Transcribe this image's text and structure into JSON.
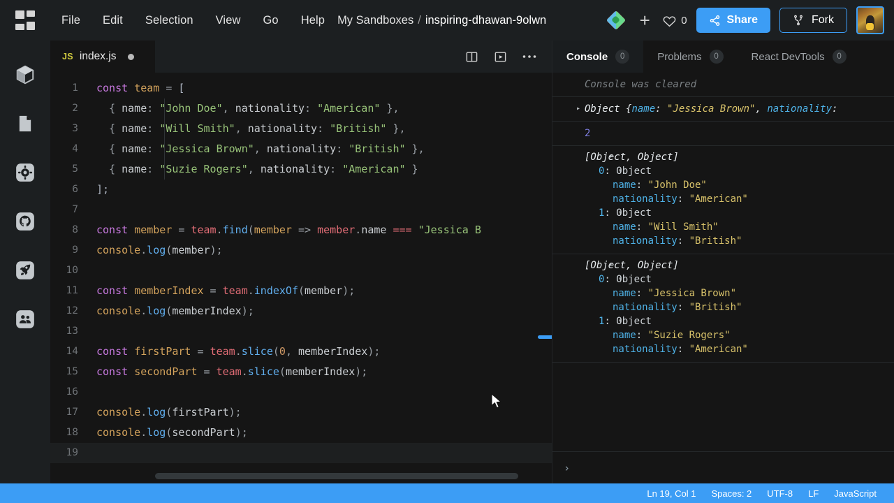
{
  "topbar": {
    "logo_icon": "grid-logo-icon",
    "menus": [
      "File",
      "Edit",
      "Selection",
      "View",
      "Go",
      "Help"
    ],
    "breadcrumb": {
      "root": "My Sandboxes",
      "separator": "/",
      "current": "inspiring-dhawan-9olwn"
    },
    "diamond_icon": "codesandbox-diamond-icon",
    "plus_icon": "plus-icon",
    "heart_icon": "heart-icon",
    "likes_count": "0",
    "share_label": "Share",
    "share_icon": "share-icon",
    "fork_label": "Fork",
    "fork_icon": "fork-icon",
    "avatar_alt": "user-avatar",
    "accent_color": "#3c9df5"
  },
  "activitybar": {
    "items": [
      {
        "name": "sidebar-item-explorer",
        "icon": "cube-icon"
      },
      {
        "name": "sidebar-item-files",
        "icon": "file-icon"
      },
      {
        "name": "sidebar-item-settings",
        "icon": "gear-icon"
      },
      {
        "name": "sidebar-item-github",
        "icon": "github-icon"
      },
      {
        "name": "sidebar-item-deploy",
        "icon": "rocket-icon"
      },
      {
        "name": "sidebar-item-live",
        "icon": "people-icon"
      }
    ]
  },
  "editor": {
    "tab": {
      "lang_badge": "JS",
      "filename": "index.js",
      "modified": true
    },
    "actions": [
      {
        "name": "split-editor-icon"
      },
      {
        "name": "run-preview-icon"
      },
      {
        "name": "more-options-icon"
      }
    ],
    "lines": [
      {
        "n": "1",
        "tokens": [
          [
            "t-kw",
            "const"
          ],
          [
            "t-op",
            " "
          ],
          [
            "t-var",
            "team"
          ],
          [
            "t-op",
            " = "
          ],
          [
            "t-punct",
            "["
          ]
        ]
      },
      {
        "n": "2",
        "tokens": [
          [
            "t-op",
            "  { "
          ],
          [
            "t-prop",
            "name"
          ],
          [
            "t-op",
            ": "
          ],
          [
            "t-str",
            "\"John Doe\""
          ],
          [
            "t-op",
            ", "
          ],
          [
            "t-prop",
            "nationality"
          ],
          [
            "t-op",
            ": "
          ],
          [
            "t-str",
            "\"American\""
          ],
          [
            "t-op",
            " },"
          ]
        ]
      },
      {
        "n": "3",
        "tokens": [
          [
            "t-op",
            "  { "
          ],
          [
            "t-prop",
            "name"
          ],
          [
            "t-op",
            ": "
          ],
          [
            "t-str",
            "\"Will Smith\""
          ],
          [
            "t-op",
            ", "
          ],
          [
            "t-prop",
            "nationality"
          ],
          [
            "t-op",
            ": "
          ],
          [
            "t-str",
            "\"British\""
          ],
          [
            "t-op",
            " },"
          ]
        ]
      },
      {
        "n": "4",
        "tokens": [
          [
            "t-op",
            "  { "
          ],
          [
            "t-prop",
            "name"
          ],
          [
            "t-op",
            ": "
          ],
          [
            "t-str",
            "\"Jessica Brown\""
          ],
          [
            "t-op",
            ", "
          ],
          [
            "t-prop",
            "nationality"
          ],
          [
            "t-op",
            ": "
          ],
          [
            "t-str",
            "\"British\""
          ],
          [
            "t-op",
            " },"
          ]
        ]
      },
      {
        "n": "5",
        "tokens": [
          [
            "t-op",
            "  { "
          ],
          [
            "t-prop",
            "name"
          ],
          [
            "t-op",
            ": "
          ],
          [
            "t-str",
            "\"Suzie Rogers\""
          ],
          [
            "t-op",
            ", "
          ],
          [
            "t-prop",
            "nationality"
          ],
          [
            "t-op",
            ": "
          ],
          [
            "t-str",
            "\"American\""
          ],
          [
            "t-op",
            " }"
          ]
        ]
      },
      {
        "n": "6",
        "tokens": [
          [
            "t-punct",
            "];"
          ]
        ]
      },
      {
        "n": "7",
        "tokens": []
      },
      {
        "n": "8",
        "tokens": [
          [
            "t-kw",
            "const"
          ],
          [
            "t-op",
            " "
          ],
          [
            "t-var",
            "member"
          ],
          [
            "t-op",
            " = "
          ],
          [
            "t-team",
            "team"
          ],
          [
            "t-op",
            "."
          ],
          [
            "t-fn",
            "find"
          ],
          [
            "t-op",
            "("
          ],
          [
            "t-var",
            "member"
          ],
          [
            "t-op",
            " => "
          ],
          [
            "t-team",
            "member"
          ],
          [
            "t-op",
            "."
          ],
          [
            "t-prop",
            "name"
          ],
          [
            "t-op",
            " "
          ],
          [
            "t-eq",
            "==="
          ],
          [
            "t-op",
            " "
          ],
          [
            "t-str",
            "\"Jessica B"
          ]
        ]
      },
      {
        "n": "9",
        "tokens": [
          [
            "t-var",
            "console"
          ],
          [
            "t-op",
            "."
          ],
          [
            "t-fn",
            "log"
          ],
          [
            "t-op",
            "("
          ],
          [
            "t-prop",
            "member"
          ],
          [
            "t-op",
            ");"
          ]
        ]
      },
      {
        "n": "10",
        "tokens": []
      },
      {
        "n": "11",
        "tokens": [
          [
            "t-kw",
            "const"
          ],
          [
            "t-op",
            " "
          ],
          [
            "t-var",
            "memberIndex"
          ],
          [
            "t-op",
            " = "
          ],
          [
            "t-team",
            "team"
          ],
          [
            "t-op",
            "."
          ],
          [
            "t-fn",
            "indexOf"
          ],
          [
            "t-op",
            "("
          ],
          [
            "t-prop",
            "member"
          ],
          [
            "t-op",
            ");"
          ]
        ]
      },
      {
        "n": "12",
        "tokens": [
          [
            "t-var",
            "console"
          ],
          [
            "t-op",
            "."
          ],
          [
            "t-fn",
            "log"
          ],
          [
            "t-op",
            "("
          ],
          [
            "t-prop",
            "memberIndex"
          ],
          [
            "t-op",
            ");"
          ]
        ]
      },
      {
        "n": "13",
        "tokens": []
      },
      {
        "n": "14",
        "tokens": [
          [
            "t-kw",
            "const"
          ],
          [
            "t-op",
            " "
          ],
          [
            "t-var",
            "firstPart"
          ],
          [
            "t-op",
            " = "
          ],
          [
            "t-team",
            "team"
          ],
          [
            "t-op",
            "."
          ],
          [
            "t-fn",
            "slice"
          ],
          [
            "t-op",
            "("
          ],
          [
            "t-num",
            "0"
          ],
          [
            "t-op",
            ", "
          ],
          [
            "t-prop",
            "memberIndex"
          ],
          [
            "t-op",
            ");"
          ]
        ]
      },
      {
        "n": "15",
        "tokens": [
          [
            "t-kw",
            "const"
          ],
          [
            "t-op",
            " "
          ],
          [
            "t-var",
            "secondPart"
          ],
          [
            "t-op",
            " = "
          ],
          [
            "t-team",
            "team"
          ],
          [
            "t-op",
            "."
          ],
          [
            "t-fn",
            "slice"
          ],
          [
            "t-op",
            "("
          ],
          [
            "t-prop",
            "memberIndex"
          ],
          [
            "t-op",
            ");"
          ]
        ]
      },
      {
        "n": "16",
        "tokens": []
      },
      {
        "n": "17",
        "tokens": [
          [
            "t-var",
            "console"
          ],
          [
            "t-op",
            "."
          ],
          [
            "t-fn",
            "log"
          ],
          [
            "t-op",
            "("
          ],
          [
            "t-prop",
            "firstPart"
          ],
          [
            "t-op",
            ");"
          ]
        ]
      },
      {
        "n": "18",
        "tokens": [
          [
            "t-var",
            "console"
          ],
          [
            "t-op",
            "."
          ],
          [
            "t-fn",
            "log"
          ],
          [
            "t-op",
            "("
          ],
          [
            "t-prop",
            "secondPart"
          ],
          [
            "t-op",
            ");"
          ]
        ]
      },
      {
        "n": "19",
        "tokens": [],
        "active": true
      }
    ]
  },
  "console": {
    "tabs": [
      {
        "label": "Console",
        "badge": "0",
        "active": true
      },
      {
        "label": "Problems",
        "badge": "0",
        "active": false
      },
      {
        "label": "React DevTools",
        "badge": "0",
        "active": false
      }
    ],
    "cleared_message": "Console was cleared",
    "entries": [
      {
        "type": "collapsed-object",
        "arrow": "▸",
        "title": "Object",
        "preview": [
          {
            "k": "name",
            "v": "\"Jessica Brown\""
          },
          {
            "k": "nationality",
            "v": ""
          }
        ],
        "truncated": true
      },
      {
        "type": "number",
        "value": "2"
      },
      {
        "type": "expanded-array",
        "arrow": "▾",
        "title": "[Object, Object]",
        "children": [
          {
            "index": "0",
            "label": "Object",
            "props": [
              {
                "k": "name",
                "v": "\"John Doe\""
              },
              {
                "k": "nationality",
                "v": "\"American\""
              }
            ]
          },
          {
            "index": "1",
            "label": "Object",
            "props": [
              {
                "k": "name",
                "v": "\"Will Smith\""
              },
              {
                "k": "nationality",
                "v": "\"British\""
              }
            ]
          }
        ]
      },
      {
        "type": "expanded-array",
        "arrow": "▾",
        "title": "[Object, Object]",
        "children": [
          {
            "index": "0",
            "label": "Object",
            "props": [
              {
                "k": "name",
                "v": "\"Jessica Brown\""
              },
              {
                "k": "nationality",
                "v": "\"British\""
              }
            ]
          },
          {
            "index": "1",
            "label": "Object",
            "props": [
              {
                "k": "name",
                "v": "\"Suzie Rogers\""
              },
              {
                "k": "nationality",
                "v": "\"American\""
              }
            ]
          }
        ]
      }
    ],
    "prompt_chevron": "›",
    "input_value": "",
    "input_placeholder": ""
  },
  "statusbar": {
    "items": [
      "Ln 19, Col 1",
      "Spaces: 2",
      "UTF-8",
      "LF",
      "JavaScript"
    ],
    "background": "#3c9df5"
  }
}
